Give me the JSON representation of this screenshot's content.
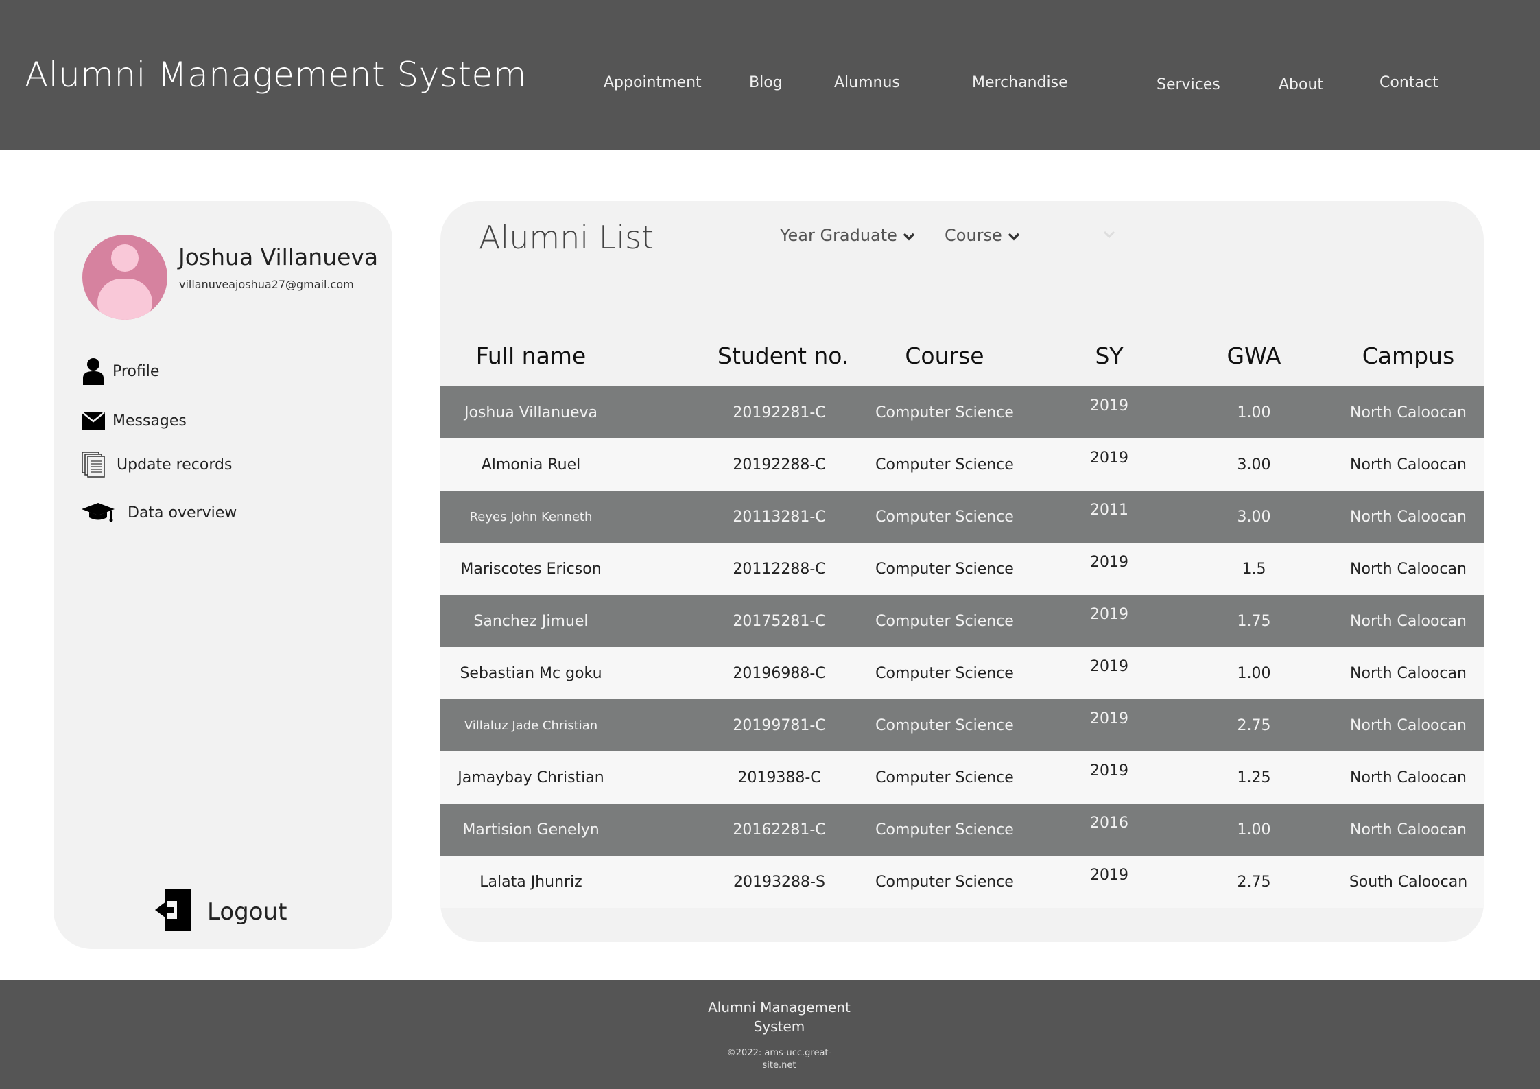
{
  "header": {
    "title": "Alumni Management System",
    "nav": [
      "Appointment",
      "Blog",
      "Alumnus",
      "Merchandise",
      "Services",
      "About",
      "Contact"
    ]
  },
  "sidebar": {
    "user_name": "Joshua Villanueva",
    "user_email": "villanuveajoshua27@gmail.com",
    "menu": [
      {
        "label": "Profile",
        "icon": "user-icon"
      },
      {
        "label": "Messages",
        "icon": "envelope-icon"
      },
      {
        "label": "Update records",
        "icon": "documents-icon"
      },
      {
        "label": "Data overview",
        "icon": "graduation-cap-icon"
      }
    ],
    "logout_label": "Logout",
    "avatar_color": "#d6829f"
  },
  "main": {
    "title": "Alumni List",
    "filters": [
      "Year Graduate",
      "Course"
    ],
    "columns": [
      "Full name",
      "Student no.",
      "Course",
      "SY",
      "GWA",
      "Campus"
    ],
    "rows": [
      [
        "Joshua Villanueva",
        "20192281-C",
        "Computer Science",
        "2019",
        "1.00",
        "North Caloocan"
      ],
      [
        "Almonia Ruel",
        "20192288-C",
        "Computer Science",
        "2019",
        "3.00",
        "North Caloocan"
      ],
      [
        "Reyes John Kenneth",
        "20113281-C",
        "Computer Science",
        "2011",
        "3.00",
        "North Caloocan"
      ],
      [
        "Mariscotes Ericson",
        "20112288-C",
        "Computer Science",
        "2019",
        "1.5",
        "North Caloocan"
      ],
      [
        "Sanchez Jimuel",
        "20175281-C",
        "Computer Science",
        "2019",
        "1.75",
        "North Caloocan"
      ],
      [
        "Sebastian Mc goku",
        "20196988-C",
        "Computer Science",
        "2019",
        "1.00",
        "North Caloocan"
      ],
      [
        "Villaluz Jade Christian",
        "20199781-C",
        "Computer Science",
        "2019",
        "2.75",
        "North Caloocan"
      ],
      [
        "Jamaybay Christian",
        "2019388-C",
        "Computer Science",
        "2019",
        "1.25",
        "North Caloocan"
      ],
      [
        "Martision Genelyn",
        "20162281-C",
        "Computer Science",
        "2016",
        "1.00",
        "North Caloocan"
      ],
      [
        "Lalata Jhunriz",
        "20193288-S",
        "Computer Science",
        "2019",
        "2.75",
        "South Caloocan"
      ]
    ]
  },
  "footer": {
    "title": "Alumni Management System",
    "copyright": "©2022: ams-ucc.great-site.net"
  },
  "colors": {
    "header_bg": "#555555",
    "row_dark": "#7a7c7c",
    "row_light": "#f7f7f7",
    "card_bg": "#f2f2f2"
  }
}
